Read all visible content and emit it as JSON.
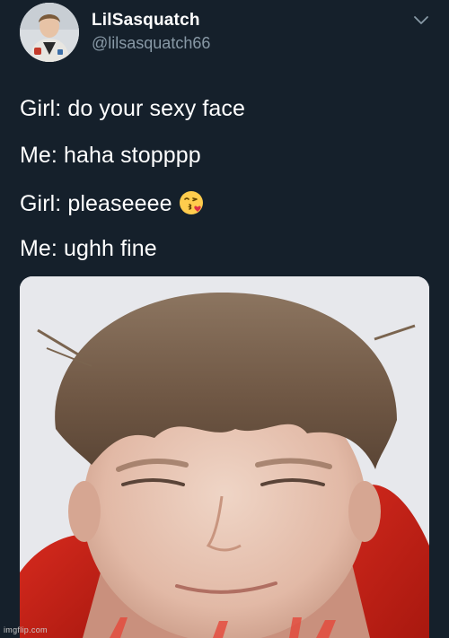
{
  "author": {
    "display_name": "LilSasquatch",
    "handle": "@lilsasquatch66",
    "avatar_icon": "user-avatar-photo"
  },
  "tweet": {
    "lines": [
      "Girl: do your sexy face",
      "Me: haha stopppp",
      "Girl: pleaseeee",
      "Me: ughh fine"
    ],
    "emoji": "face-blowing-a-kiss-icon"
  },
  "menu_icon": "chevron-down-icon",
  "media": {
    "description_icon": "attached-photo"
  },
  "watermark": "imgflip.com",
  "colors": {
    "background": "#15202b",
    "text": "#ffffff",
    "secondary_text": "#8899a6"
  }
}
